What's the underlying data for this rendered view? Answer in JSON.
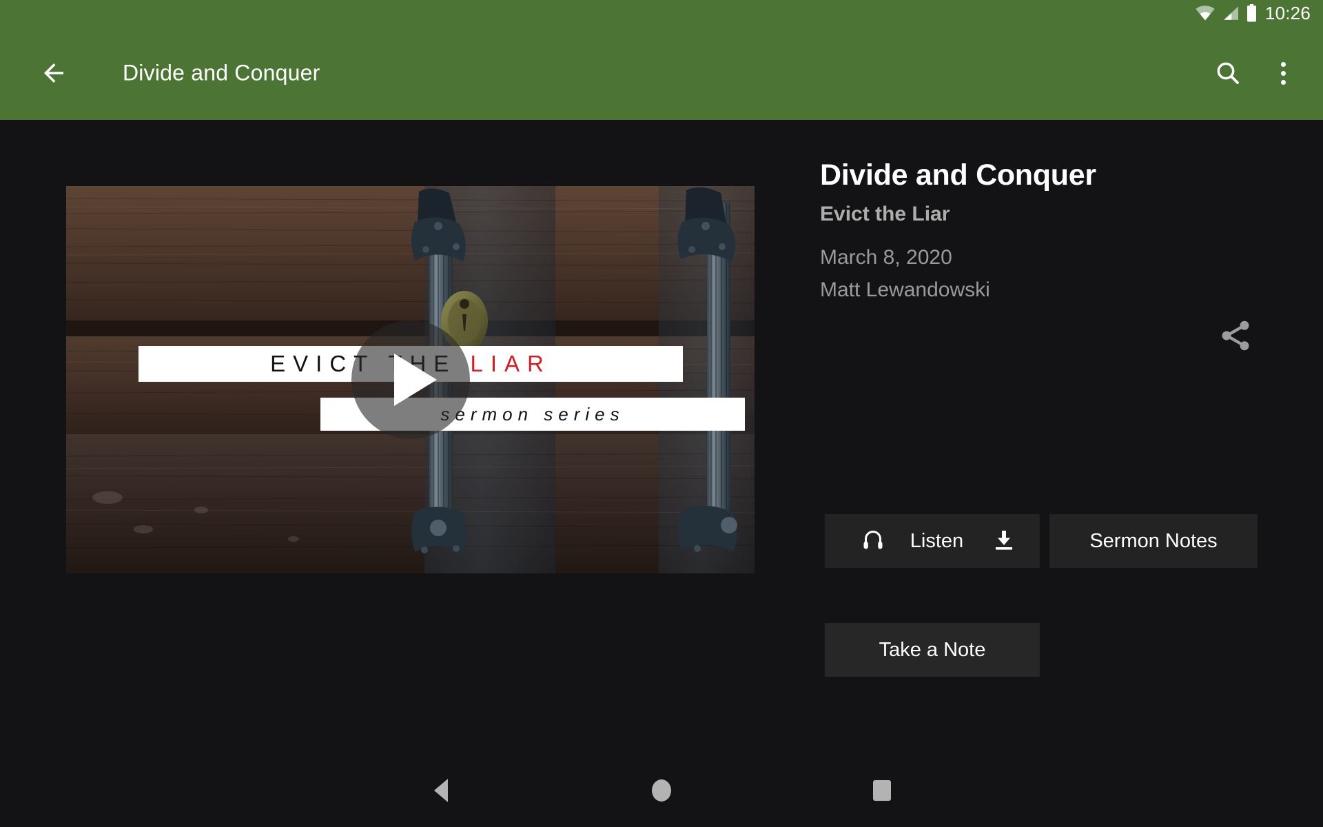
{
  "statusbar": {
    "time": "10:26",
    "icons": [
      "wifi-icon",
      "cellular-signal-icon",
      "battery-icon"
    ]
  },
  "toolbar": {
    "title": "Divide and Conquer",
    "back_icon": "back-arrow-icon",
    "search_icon": "search-icon",
    "overflow_icon": "overflow-menu-icon",
    "background_color": "#4c7535"
  },
  "video": {
    "play_icon": "play-button-icon",
    "overlay_line1_part1": "EVICT THE ",
    "overlay_line1_part2": "LIAR",
    "overlay_line2": "sermon series",
    "accent_color": "#cc2127",
    "alt": "Rustic wooden door with iron handles and brass lock"
  },
  "details": {
    "title": "Divide and Conquer",
    "series": "Evict the Liar",
    "date": "March 8, 2020",
    "speaker": "Matt Lewandowski",
    "share_icon": "share-icon"
  },
  "actions": {
    "listen_label": "Listen",
    "listen_icon": "headphones-icon",
    "download_icon": "download-icon",
    "sermon_notes_label": "Sermon Notes",
    "take_note_label": "Take a Note"
  },
  "navbar": {
    "back": "nav-back-icon",
    "home": "nav-home-icon",
    "recents": "nav-recents-icon"
  },
  "theme": {
    "background": "#131316",
    "toolbar": "#4c7535",
    "button": "#232323",
    "text_primary": "#ffffff",
    "text_secondary": "#9a9a9a"
  }
}
